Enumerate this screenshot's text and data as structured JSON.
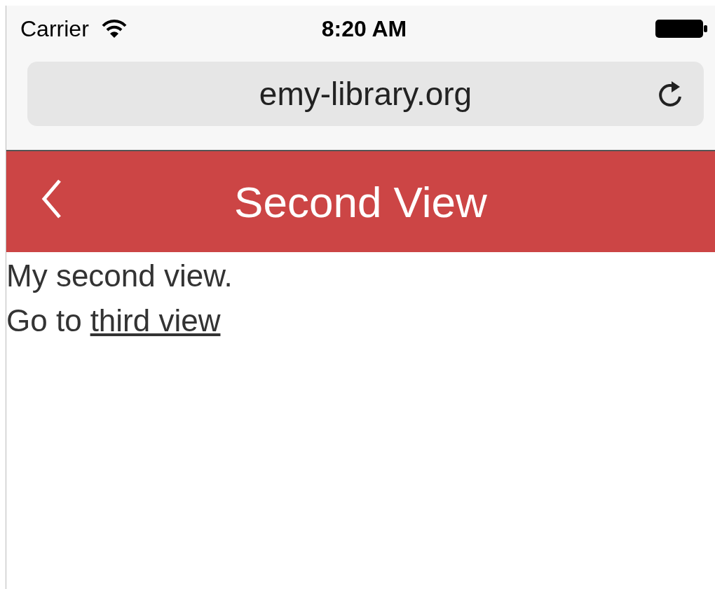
{
  "status_bar": {
    "carrier": "Carrier",
    "time": "8:20 AM"
  },
  "address_bar": {
    "url": "emy-library.org"
  },
  "nav_bar": {
    "title": "Second View"
  },
  "content": {
    "paragraph": "My second view.",
    "link_prefix": "Go to",
    "link": "third view"
  }
}
